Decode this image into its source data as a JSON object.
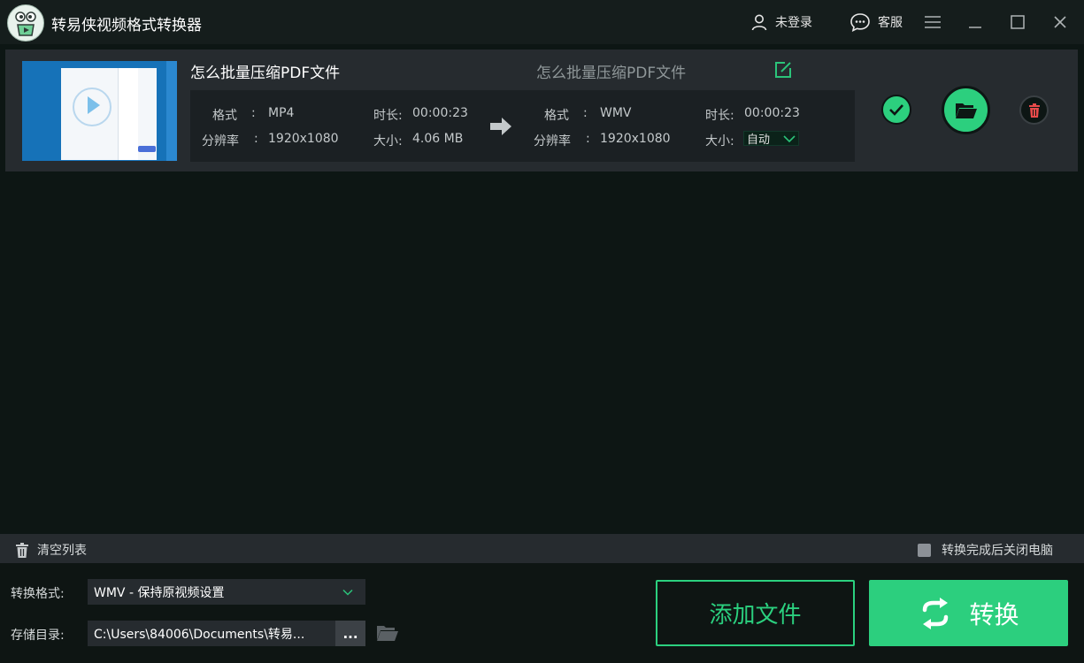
{
  "app": {
    "title": "转易侠视频格式转换器"
  },
  "header": {
    "login_label": "未登录",
    "service_label": "客服"
  },
  "file": {
    "name": "怎么批量压缩PDF文件",
    "output_name": "怎么批量压缩PDF文件",
    "source": {
      "format_label": "格式",
      "format_value": "MP4",
      "resolution_label": "分辨率",
      "resolution_value": "1920x1080",
      "duration_label": "时长:",
      "duration_value": "00:00:23",
      "size_label": "大小:",
      "size_value": "4.06 MB"
    },
    "target": {
      "format_label": "格式",
      "format_value": "WMV",
      "resolution_label": "分辨率",
      "resolution_value": "1920x1080",
      "duration_label": "时长:",
      "duration_value": "00:00:23",
      "size_label": "大小:",
      "size_value": "自动"
    },
    "sep": ":"
  },
  "list_bar": {
    "clear_label": "清空列表",
    "shutdown_label": "转换完成后关闭电脑",
    "shutdown_checked": false
  },
  "bottom": {
    "format_label": "转换格式:",
    "format_value": "WMV - 保持原视频设置",
    "dir_label": "存储目录:",
    "dir_value": "C:\\Users\\84006\\Documents\\转易...",
    "browse_label": "...",
    "add_label": "添加文件",
    "convert_label": "转换"
  },
  "colors": {
    "accent": "#2ccf7e",
    "background": "#0d1614",
    "panel": "#262b2f",
    "delete": "#e84a4a"
  }
}
